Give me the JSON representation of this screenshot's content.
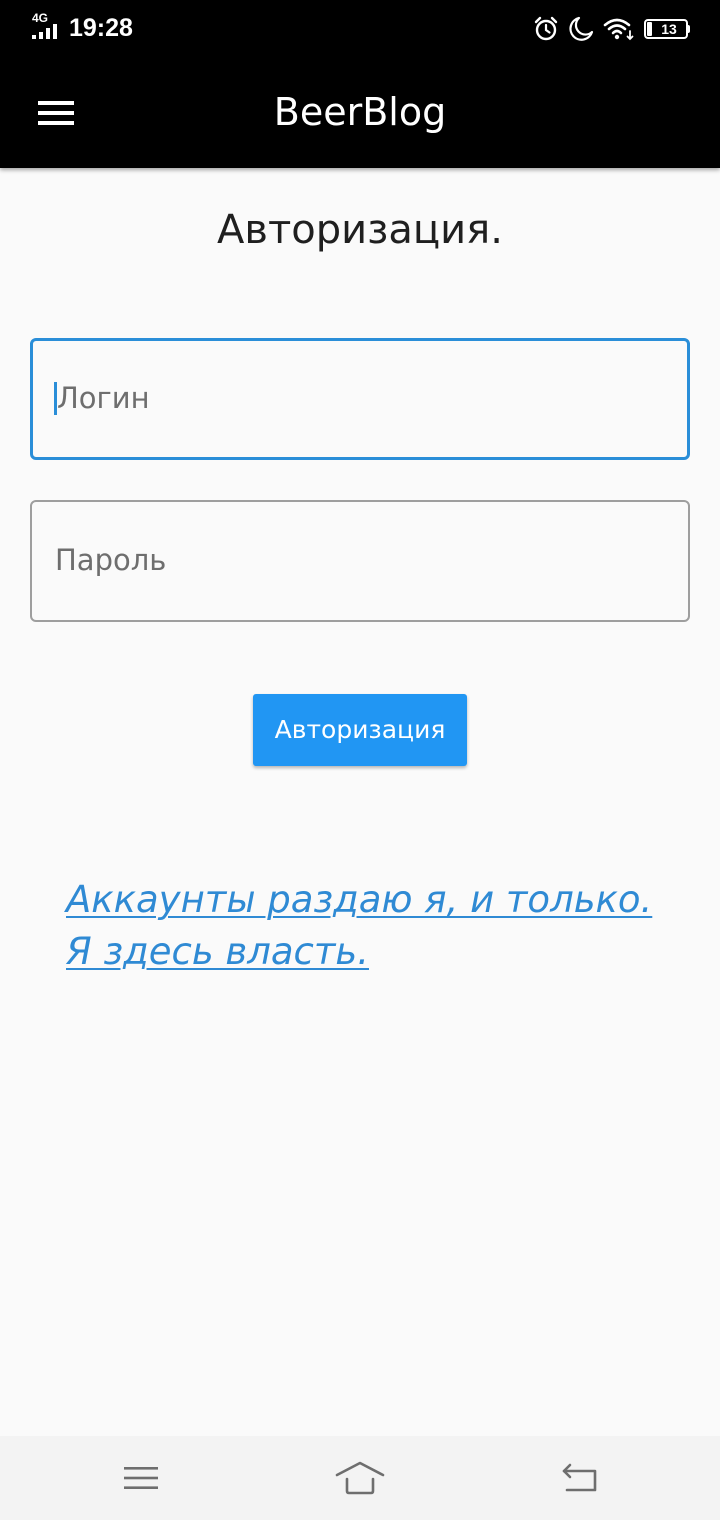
{
  "status_bar": {
    "network": "4G",
    "time": "19:28",
    "battery": "13",
    "icons": [
      "signal-icon",
      "alarm-icon",
      "do-not-disturb-icon",
      "wifi-icon",
      "battery-icon"
    ]
  },
  "app_bar": {
    "title": "BeerBlog",
    "menu_icon": "hamburger-menu-icon",
    "background": "#000000"
  },
  "main": {
    "heading": "Авторизация.",
    "login": {
      "placeholder": "Логин",
      "value": "",
      "focused": true
    },
    "password": {
      "placeholder": "Пароль",
      "value": ""
    },
    "submit_label": "Авторизация",
    "info_link_lines": [
      "Аккаунты раздаю я, и только.",
      "Я здесь власть."
    ]
  },
  "nav_bar": {
    "icons": [
      "recent-apps-icon",
      "home-icon",
      "back-icon"
    ]
  },
  "colors": {
    "accent": "#2196f3",
    "focus_border": "#2a8ed8",
    "link": "#2f8ad4",
    "page_background": "#fafafa"
  }
}
